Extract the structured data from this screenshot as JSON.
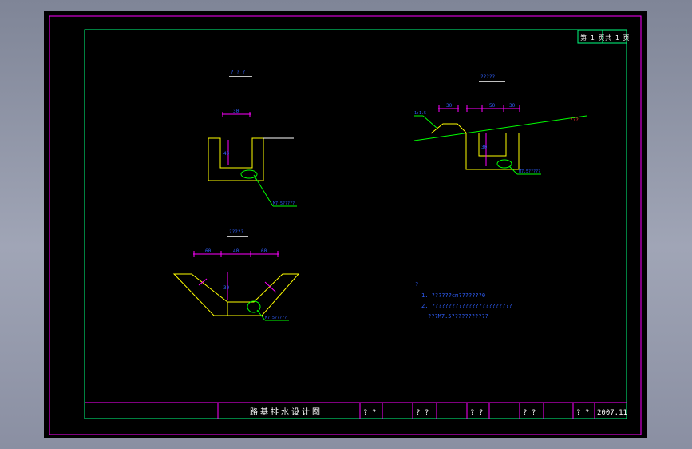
{
  "sheet": {
    "page_label": "第 1 页",
    "total_label": "共 1 页"
  },
  "title_block": {
    "title": "路基排水设计图",
    "cells": [
      "? ?",
      "? ?",
      "? ?",
      "? ?",
      "? ?"
    ],
    "date": "2007.11"
  },
  "sections": {
    "section1_title": "? ? ?",
    "section2_title": "?????",
    "section3_title": "?????"
  },
  "dimensions": {
    "d1_width": "30",
    "d1_depth": "40",
    "d2_left": "60",
    "d2_mid": "40",
    "d2_right": "60",
    "d2_depth": "30",
    "d3_a": "30",
    "d3_b": "50",
    "d3_c": "30",
    "d3_depth": "30"
  },
  "callouts": {
    "c1": "M7.5?????",
    "c2": "M7.5?????",
    "c3": "M7.5?????",
    "slope": "1:1.5",
    "grade": "???"
  },
  "notes": {
    "header": "?",
    "line1": "1. ??????cm???????0",
    "line2": "2. ????????????????????????",
    "line3": "???M7.5???????????"
  },
  "colors": {
    "border_magenta": "#ff00ff",
    "frame_green": "#00ff7f",
    "ditch_yellow": "#ffff00",
    "dim_magenta": "#ff00ff",
    "text_blue": "#3060ff",
    "leader_green": "#00ff00",
    "white": "#ffffff",
    "red": "#ff3030"
  }
}
